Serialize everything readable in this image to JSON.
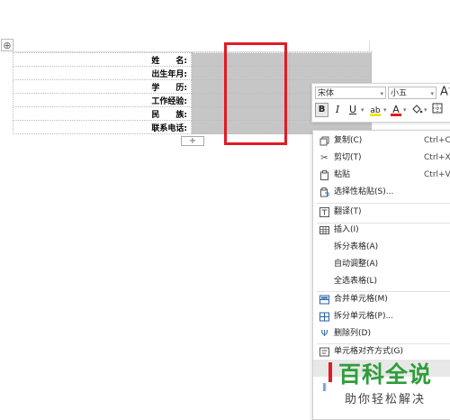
{
  "document": {
    "add_row_label": "+",
    "move_handle_label": "⊕",
    "form_labels": [
      "姓　　名:",
      "出生年月:",
      "学　　历:",
      "工作经验:",
      "民　　族:",
      "联系电话:"
    ]
  },
  "mini_toolbar": {
    "font_name": "宋体",
    "font_size": "小五",
    "grow_font": "A",
    "bold": "B",
    "italic": "I",
    "underline": "U",
    "highlight": "ab",
    "font_color": "A"
  },
  "context_menu": {
    "items": [
      {
        "label": "复制(C)",
        "shortcut": "Ctrl+C",
        "icon": "copy-icon"
      },
      {
        "label": "剪切(T)",
        "shortcut": "Ctrl+X",
        "icon": "scissors-icon"
      },
      {
        "label": "粘贴",
        "shortcut": "Ctrl+V",
        "icon": "paste-icon"
      },
      {
        "label": "选择性粘贴(S)...",
        "shortcut": "",
        "icon": "paste-special-icon"
      },
      {
        "label": "翻译(T)",
        "shortcut": "",
        "icon": "translate-icon"
      },
      {
        "label": "插入(I)",
        "shortcut": "",
        "icon": "insert-table-icon"
      },
      {
        "label": "拆分表格(A)",
        "shortcut": "",
        "icon": ""
      },
      {
        "label": "自动调整(A)",
        "shortcut": "",
        "icon": ""
      },
      {
        "label": "全选表格(L)",
        "shortcut": "",
        "icon": ""
      },
      {
        "label": "合并单元格(M)",
        "shortcut": "",
        "icon": "merge-cells-icon"
      },
      {
        "label": "拆分单元格(P)...",
        "shortcut": "",
        "icon": "split-cells-icon"
      },
      {
        "label": "删除列(D)",
        "shortcut": "",
        "icon": "delete-column-icon"
      },
      {
        "label": "单元格对齐方式(G)",
        "shortcut": "",
        "icon": "cell-align-icon"
      }
    ]
  },
  "watermark": {
    "title": "百科全说",
    "subtitle": "助你轻松解决"
  },
  "colors": {
    "highlight_box": "#e01b24",
    "selected_cells": "#c6c6c6",
    "watermark_green": "#2e9e3a"
  }
}
